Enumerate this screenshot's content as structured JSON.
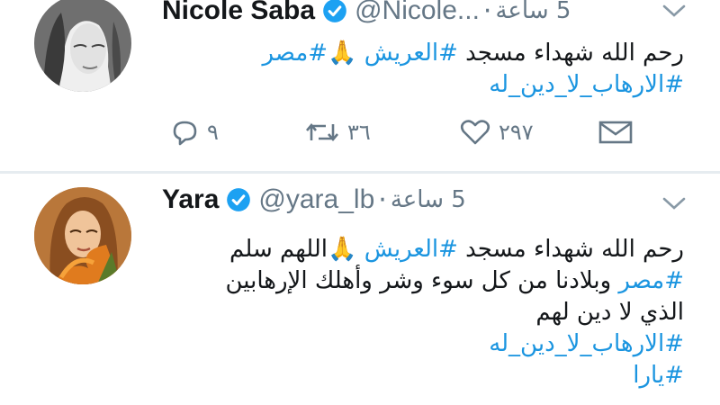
{
  "tweets": [
    {
      "name": "Nicole Saba",
      "handle": "@Nicole...",
      "separator": "·",
      "time": "5 ساعة",
      "body_lines": [
        [
          {
            "text": "رحم الله شهداء مسجد ",
            "tag": false
          },
          {
            "text": "#العريش",
            "tag": true
          },
          {
            "text": " 🙏",
            "tag": false
          },
          {
            "text": "#مصر",
            "tag": true
          }
        ],
        [
          {
            "text": "#الارهاب_لا_دين_له",
            "tag": true
          }
        ]
      ],
      "reply_count": "٩",
      "retweet_count": "٣٦",
      "like_count": "٢٩٧"
    },
    {
      "name": "Yara",
      "handle": "@yara_lb",
      "separator": "·",
      "time": "5 ساعة",
      "body_lines": [
        [
          {
            "text": "رحم الله شهداء مسجد ",
            "tag": false
          },
          {
            "text": "#العريش",
            "tag": true
          },
          {
            "text": " 🙏",
            "tag": false
          },
          {
            "text": "اللهم سلم",
            "tag": false
          }
        ],
        [
          {
            "text": "#مصر",
            "tag": true
          },
          {
            "text": " وبلادنا من كل سوء وشر وأهلك الإرهابين",
            "tag": false
          }
        ],
        [
          {
            "text": "الذي لا دين لهم",
            "tag": false
          }
        ],
        [
          {
            "text": "#الارهاب_لا_دين_له",
            "tag": true
          }
        ],
        [
          {
            "text": "#يارا",
            "tag": true
          }
        ]
      ]
    }
  ],
  "colors": {
    "link": "#1b95e0",
    "muted": "#657786",
    "verified": "#1da1f2",
    "text": "#14171a"
  },
  "icons": [
    "reply-icon",
    "retweet-icon",
    "like-icon",
    "direct-message-icon",
    "verified-icon",
    "chevron-down-icon"
  ]
}
